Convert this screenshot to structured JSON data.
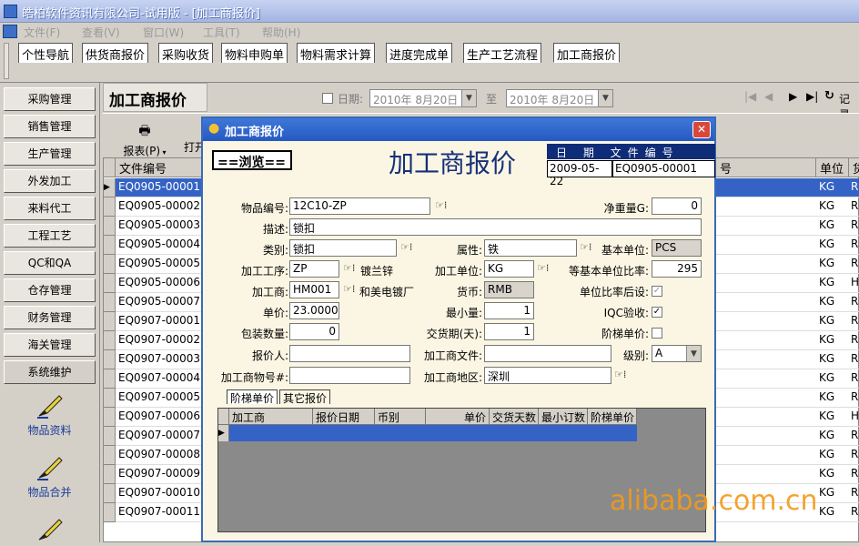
{
  "window": {
    "title": "皓柏软件资讯有限公司-试用版 - [加工商报价]"
  },
  "menu": [
    "文件(F)",
    "查看(V)",
    "窗口(W)",
    "工具(T)",
    "帮助(H)"
  ],
  "tabs": [
    "个性导航",
    "供货商报价",
    "采购收货",
    "物料申购单",
    "物料需求计算",
    "进度完成单",
    "生产工艺流程",
    "加工商报价"
  ],
  "sidebar": {
    "items": [
      "采购管理",
      "销售管理",
      "生产管理",
      "外发加工",
      "来料代工",
      "工程工艺",
      "QC和QA",
      "仓存管理",
      "财务管理",
      "海关管理",
      "系统维护"
    ],
    "big": [
      "物品资料",
      "物品合并"
    ]
  },
  "main": {
    "title": "加工商报价",
    "date_label": "日期:",
    "date_from": "2010年 8月20日",
    "to": "至",
    "date_to": "2010年 8月20日",
    "nav_label": "记录",
    "report": "报表(P)",
    "print": "打开"
  },
  "grid": {
    "headers": [
      "文件编号",
      "号",
      "单位",
      "货"
    ],
    "rows": [
      {
        "id": "EQ0905-00001",
        "unit": "KG",
        "c": "RI"
      },
      {
        "id": "EQ0905-00002",
        "unit": "KG",
        "c": "RI"
      },
      {
        "id": "EQ0905-00003",
        "unit": "KG",
        "c": "RI"
      },
      {
        "id": "EQ0905-00004",
        "unit": "KG",
        "c": "RI"
      },
      {
        "id": "EQ0905-00005",
        "unit": "KG",
        "c": "RI"
      },
      {
        "id": "EQ0905-00006",
        "unit": "KG",
        "c": "HI"
      },
      {
        "id": "EQ0905-00007",
        "unit": "KG",
        "c": "RI"
      },
      {
        "id": "EQ0907-00001",
        "unit": "KG",
        "c": "RI"
      },
      {
        "id": "EQ0907-00002",
        "unit": "KG",
        "c": "RI"
      },
      {
        "id": "EQ0907-00003",
        "unit": "KG",
        "c": "RI"
      },
      {
        "id": "EQ0907-00004",
        "unit": "KG",
        "c": "RI"
      },
      {
        "id": "EQ0907-00005",
        "unit": "KG",
        "c": "RI"
      },
      {
        "id": "EQ0907-00006",
        "unit": "KG",
        "c": "HI"
      },
      {
        "id": "EQ0907-00007",
        "unit": "KG",
        "c": "RI"
      },
      {
        "id": "EQ0907-00008",
        "unit": "KG",
        "c": "RI"
      },
      {
        "id": "EQ0907-00009",
        "unit": "KG",
        "c": "RI"
      },
      {
        "id": "EQ0907-00010",
        "unit": "KG",
        "c": "RI"
      },
      {
        "id": "EQ0907-00011",
        "unit": "KG",
        "c": "RI"
      }
    ]
  },
  "dialog": {
    "title": "加工商报价",
    "browse": "==浏览==",
    "heading": "加工商报价",
    "doc_header": "日 期 文件编号",
    "doc_date": "2009-05-22",
    "doc_no": "EQ0905-00001",
    "labels": {
      "item_no": "物品编号:",
      "net_weight": "净重量G:",
      "desc": "描述:",
      "category": "类别:",
      "attribute": "属性:",
      "base_unit": "基本单位:",
      "process": "加工工序:",
      "proc_unit": "加工单位:",
      "ratio": "等基本单位比率:",
      "vendor": "加工商:",
      "currency": "货币:",
      "ratio_after": "单位比率后设:",
      "price": "单价:",
      "min_qty": "最小量:",
      "iqc": "IQC验收:",
      "pack_qty": "包装数量:",
      "lead_days": "交货期(天):",
      "tier_price": "阶梯单价:",
      "quoter": "报价人:",
      "vendor_file": "加工商文件:",
      "level": "级别:",
      "vendor_item": "加工商物号#:",
      "vendor_area": "加工商地区:"
    },
    "values": {
      "item_no": "12C10-ZP",
      "net_weight": "0",
      "desc": "锁扣",
      "category": "锁扣",
      "attribute": "铁",
      "base_unit": "PCS",
      "process": "ZP",
      "process_name": "镀兰锌",
      "proc_unit": "KG",
      "ratio": "295",
      "vendor": "HM001",
      "vendor_name": "和美电镀厂",
      "currency": "RMB",
      "price": "23.0000",
      "min_qty": "1",
      "pack_qty": "0",
      "lead_days": "1",
      "quoter": "",
      "vendor_file": "",
      "level": "A",
      "vendor_item": "",
      "vendor_area": "深圳"
    },
    "subtabs": [
      "阶梯单价",
      "其它报价"
    ],
    "subgrid_headers": [
      "加工商",
      "报价日期",
      "币别",
      "单价",
      "交货天数",
      "最小订数",
      "阶梯单价"
    ]
  },
  "watermark": "alibaba.com.cn"
}
